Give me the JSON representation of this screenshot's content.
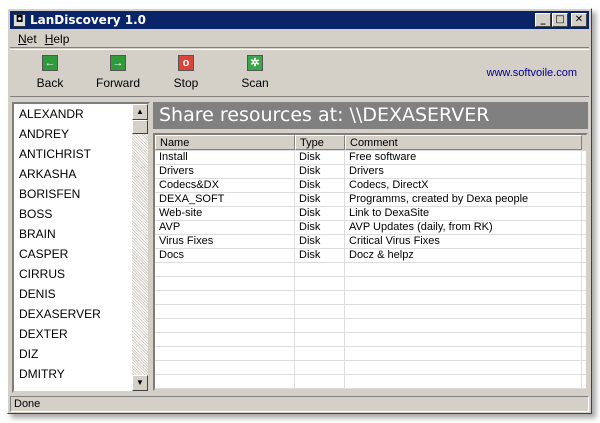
{
  "title": "LanDiscovery 1.0",
  "menu": [
    "Net",
    "Help"
  ],
  "toolbar": {
    "back": "Back",
    "forward": "Forward",
    "stop": "Stop",
    "scan": "Scan",
    "link": "www.softvoile.com"
  },
  "hosts": [
    "ALEXANDR",
    "ANDREY",
    "ANTICHRIST",
    "ARKASHA",
    "BORISFEN",
    "BOSS",
    "BRAIN",
    "CASPER",
    "CIRRUS",
    "DENIS",
    "DEXASERVER",
    "DEXTER",
    "DIZ",
    "DMITRY"
  ],
  "header": "Share resources at: \\\\DEXASERVER",
  "columns": [
    "Name",
    "Type",
    "Comment"
  ],
  "rows": [
    [
      "Install",
      "Disk",
      "Free software"
    ],
    [
      "Drivers",
      "Disk",
      "Drivers"
    ],
    [
      "Codecs&DX",
      "Disk",
      "Codecs, DirectX"
    ],
    [
      "DEXA_SOFT",
      "Disk",
      "Programms, created by Dexa people"
    ],
    [
      "Web-site",
      "Disk",
      "Link to DexaSite"
    ],
    [
      "AVP",
      "Disk",
      "AVP Updates (daily, from RK)"
    ],
    [
      "Virus Fixes",
      "Disk",
      "Critical Virus Fixes"
    ],
    [
      "Docs",
      "Disk",
      "Docz & helpz"
    ]
  ],
  "status": "Done"
}
